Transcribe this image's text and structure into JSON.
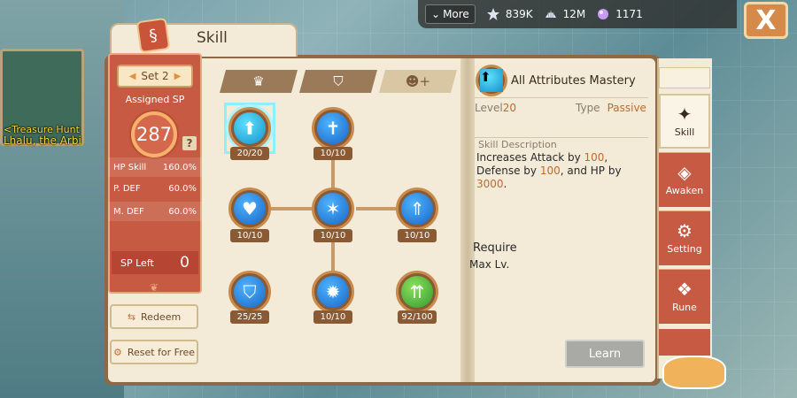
{
  "quest": {
    "line1": "<Treasure Hunt",
    "line2": "Lhalu, the Arbi"
  },
  "topbar": {
    "more_label": "More",
    "currencies": [
      {
        "icon": "star-icon",
        "value": "839K"
      },
      {
        "icon": "shell-icon",
        "value": "12M"
      },
      {
        "icon": "gem-icon",
        "value": "1171"
      }
    ],
    "close_label": "X"
  },
  "header": {
    "title": "Skill"
  },
  "stats": {
    "set_label": "Set 2",
    "assigned_label": "Assigned SP",
    "assigned_value": "287",
    "help_label": "?",
    "rows": [
      {
        "label": "HP Skill",
        "value": "160.0%"
      },
      {
        "label": "P. DEF",
        "value": "60.0%"
      },
      {
        "label": "M. DEF",
        "value": "60.0%"
      }
    ],
    "sp_left_label": "SP Left",
    "sp_left_value": "0"
  },
  "buttons": {
    "redeem": "Redeem",
    "reset": "Reset for Free",
    "learn": "Learn"
  },
  "tree": {
    "tabs": [
      {
        "icon": "crest-icon"
      },
      {
        "icon": "shield-crest-icon"
      },
      {
        "icon": "person-add-icon"
      }
    ],
    "nodes": [
      {
        "id": "attr-mastery",
        "level": "20/20",
        "icon": "arrow-up-icon"
      },
      {
        "id": "sword-shield",
        "level": "10/10",
        "icon": "sword-shield-icon"
      },
      {
        "id": "heart-shield",
        "level": "10/10",
        "icon": "heart-shield-icon"
      },
      {
        "id": "heart-star",
        "level": "10/10",
        "icon": "heart-star-icon"
      },
      {
        "id": "arrows-shield",
        "level": "10/10",
        "icon": "arrows-shield-icon"
      },
      {
        "id": "shield-up",
        "level": "25/25",
        "icon": "shield-up-icon"
      },
      {
        "id": "sun-burst",
        "level": "10/10",
        "icon": "sun-burst-icon"
      },
      {
        "id": "green-arrows",
        "level": "92/100",
        "icon": "double-arrow-up-icon"
      }
    ]
  },
  "detail": {
    "name": "All Attributes Mastery",
    "level_label": "Level",
    "level_value": "20",
    "type_label": "Type",
    "type_value": "Passive",
    "desc_head": "Skill Description",
    "desc_parts": {
      "p1": "Increases Attack by ",
      "v1": "100",
      "p2": ", Defense by ",
      "v2": "100",
      "p3": ", and HP by ",
      "v3": "3000",
      "p4": "."
    },
    "require_head": "Require",
    "require_value": "Max Lv."
  },
  "menu": {
    "items": [
      {
        "label": "Skill",
        "icon": "flame-icon"
      },
      {
        "label": "Awaken",
        "icon": "awaken-icon"
      },
      {
        "label": "Setting",
        "icon": "gear-icon"
      },
      {
        "label": "Rune",
        "icon": "rune-icon"
      }
    ]
  },
  "colors": {
    "accent": "#c75a43",
    "highlight": "#c06a2a",
    "node_border": "#c88b4c"
  }
}
